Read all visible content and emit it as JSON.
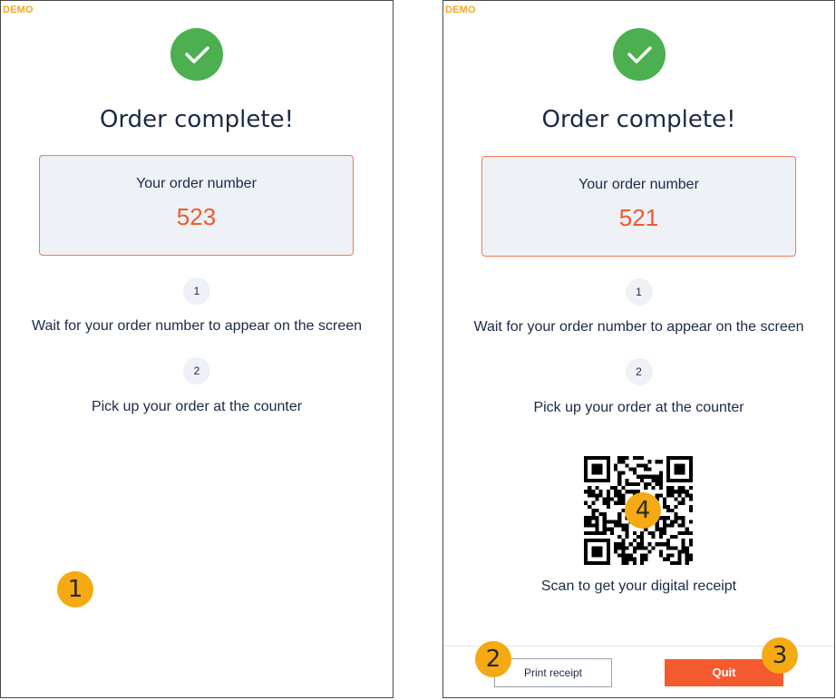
{
  "left_screen": {
    "demo_label": "DEMO",
    "title": "Order complete!",
    "order_label": "Your order number",
    "order_number": "523",
    "steps": [
      {
        "number": "1",
        "text": "Wait for your order number to appear on the screen"
      },
      {
        "number": "2",
        "text": "Pick up your order at the counter"
      }
    ]
  },
  "right_screen": {
    "demo_label": "DEMO",
    "title": "Order complete!",
    "order_label": "Your order number",
    "order_number": "521",
    "steps": [
      {
        "number": "1",
        "text": "Wait for your order number to appear on the screen"
      },
      {
        "number": "2",
        "text": "Pick up your order at the counter"
      }
    ],
    "scan_text": "Scan to get your digital receipt",
    "print_button": "Print receipt",
    "quit_button": "Quit"
  },
  "callouts": [
    "1",
    "2",
    "3",
    "4"
  ],
  "colors": {
    "success": "#4caf50",
    "accent": "#f45a2e",
    "order_number": "#f05a2a",
    "callout": "#f5a912",
    "demo": "#f5a623"
  },
  "icons": {
    "success": "checkmark-icon",
    "receipt": "qr-code"
  }
}
